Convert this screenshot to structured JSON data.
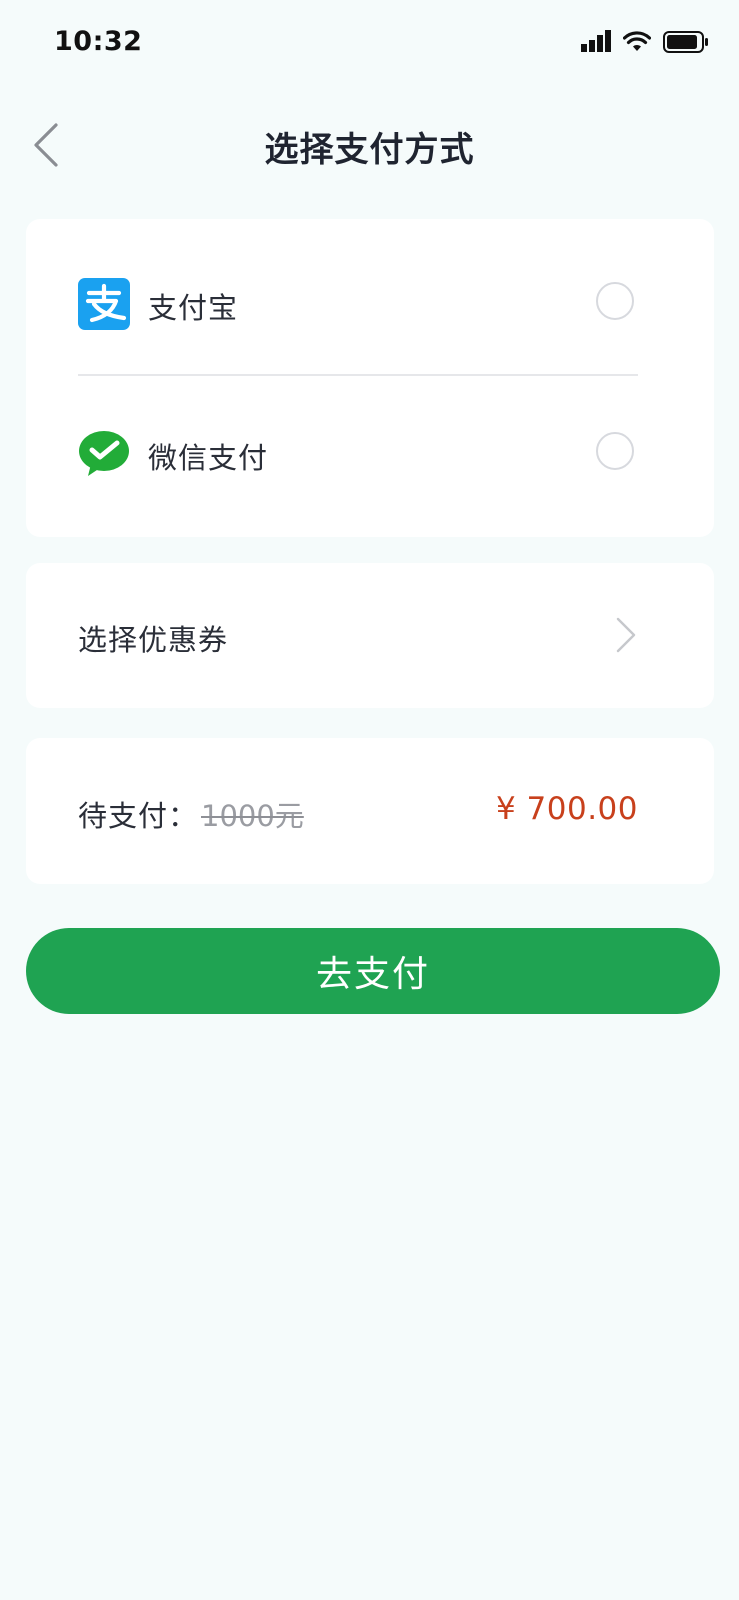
{
  "status_bar": {
    "time": "10:32"
  },
  "nav": {
    "title": "选择支付方式",
    "back_icon": "chevron-left-icon"
  },
  "payment_methods": [
    {
      "label": "支付宝",
      "icon": "alipay-icon",
      "icon_color": "#1aa1f0",
      "selected": false
    },
    {
      "label": "微信支付",
      "icon": "wechat-pay-icon",
      "icon_color": "#22ac38",
      "selected": false
    }
  ],
  "coupon": {
    "label": "选择优惠券"
  },
  "total": {
    "label": "待支付：",
    "original_price": "1000元",
    "final_price": "¥ 700.00"
  },
  "pay_button": {
    "label": "去支付"
  },
  "colors": {
    "accent_green": "#1fa352",
    "price_red": "#c8401c",
    "background": "#f5fbfb"
  }
}
